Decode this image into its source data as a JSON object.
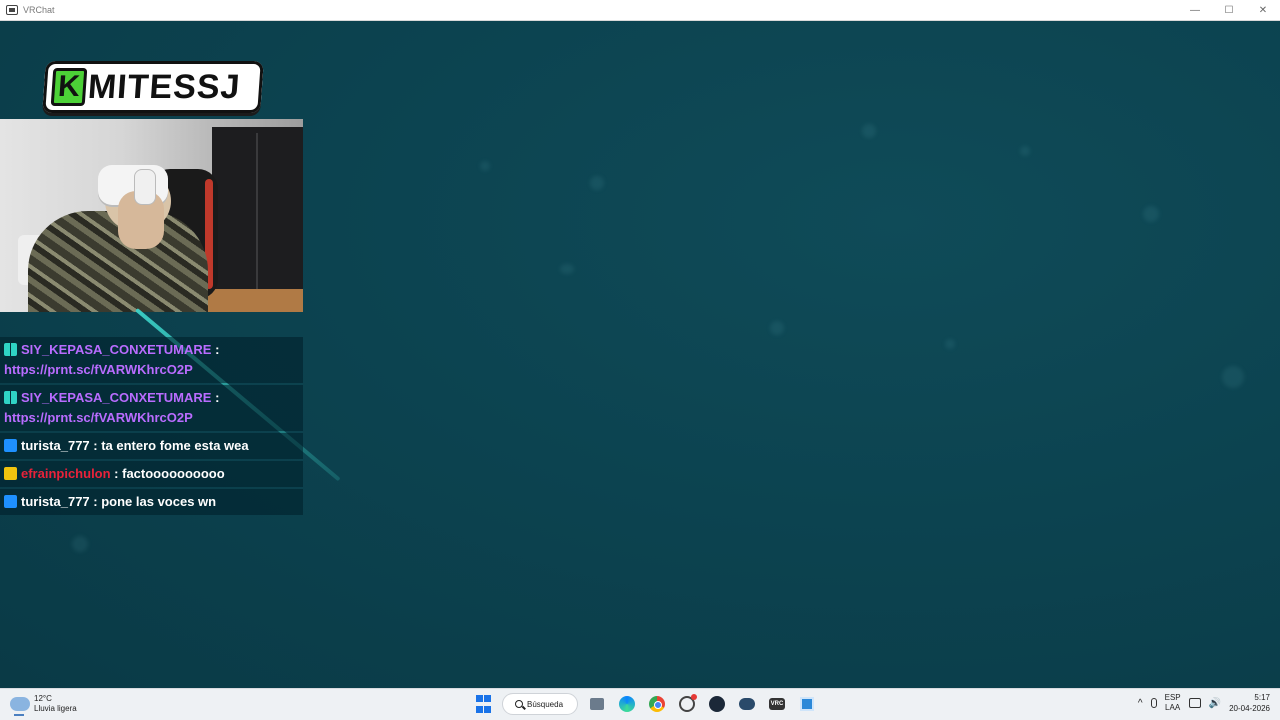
{
  "window": {
    "title": "VRChat",
    "minimize_glyph": "—",
    "maximize_glyph": "☐",
    "close_glyph": "✕"
  },
  "overlay": {
    "logo": {
      "first_letter": "K",
      "rest": "MITESSJ",
      "accent_color": "#4cd137"
    }
  },
  "chat": {
    "messages": [
      {
        "badge": "glitch-icon",
        "user": "SIY_KEPASA_CONXETUMARE",
        "separator": " :",
        "text": "https://prnt.sc/fVARWKhrcO2P",
        "user_color": "#b96cff"
      },
      {
        "badge": "glitch-icon",
        "user": "SIY_KEPASA_CONXETUMARE",
        "separator": " :",
        "text": "https://prnt.sc/fVARWKhrcO2P",
        "user_color": "#b96cff"
      },
      {
        "badge": "prime-icon",
        "user": "turista_777",
        "separator": " : ",
        "text": "ta entero fome esta wea",
        "user_color": "#ffffff"
      },
      {
        "badge": "crown-icon",
        "user": "efrainpichulon",
        "separator": " : ",
        "text": "factoooooooooo",
        "user_color": "#e8223a"
      },
      {
        "badge": "prime-icon",
        "user": "turista_777",
        "separator": " : ",
        "text": "pone las voces wn",
        "user_color": "#ffffff"
      }
    ]
  },
  "taskbar": {
    "weather": {
      "temp": "12°C",
      "desc": "Lluvia ligera"
    },
    "search_label": "Búsqueda",
    "lang_top": "ESP",
    "lang_bottom": "LAA",
    "time": "5:17",
    "date": "20-04-2026",
    "vrc_label": "VRC"
  },
  "colors": {
    "background": "#0d3b47",
    "chat_user_purple": "#b96cff",
    "chat_user_red": "#e8223a",
    "streak": "#3cd2c8"
  }
}
